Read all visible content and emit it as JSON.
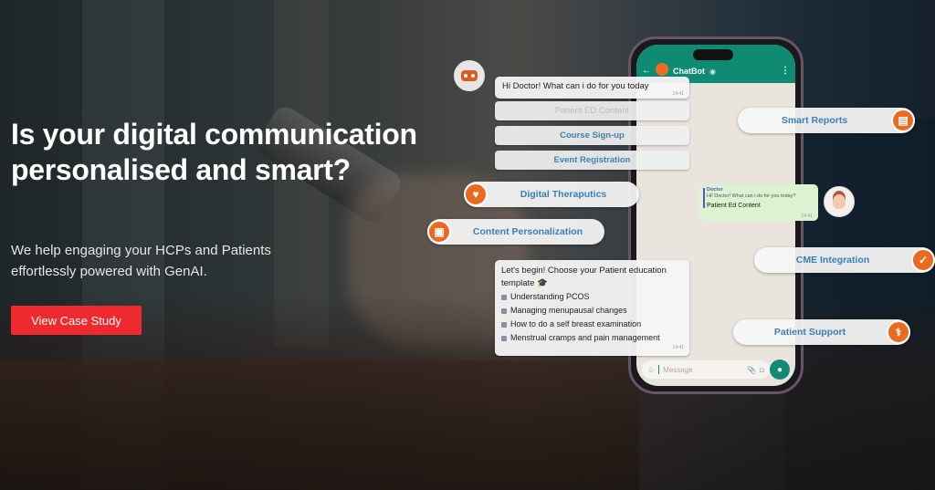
{
  "hero": {
    "title": "Is your digital communication personalised and smart?",
    "subtitle": "We help engaging your HCPs and Patients effortlessly powered with GenAI.",
    "cta_label": "View Case Study"
  },
  "colors": {
    "accent_red": "#ee2a2f",
    "whatsapp_green": "#0f8b73",
    "feature_orange": "#ea6a1f",
    "feature_text_blue": "#3c7fb6"
  },
  "phone": {
    "header_title": "ChatBot",
    "back_icon": "←",
    "menu_icon": "⋮",
    "input_placeholder": "Message",
    "mic_icon": "🎤"
  },
  "chat": {
    "greeting": "Hi Doctor! What can i do for you today",
    "greeting_time": "14:41",
    "options": [
      {
        "label": "Patient ED Content",
        "state": "disabled"
      },
      {
        "label": "Course Sign-up",
        "state": "enabled"
      },
      {
        "label": "Event Registration",
        "state": "enabled"
      }
    ],
    "doctor_reply": {
      "name": "Doctor",
      "quoted": "Hi! Doctor! What can i do for you today?",
      "text": "Patient Ed Content",
      "time": "14:41"
    },
    "template_message": {
      "intro": "Let's begin! Choose your Patient education template 🎓",
      "items": [
        "Understanding PCOS",
        "Managing menupausal changes",
        "How to do a self breast examination",
        "Menstrual cramps and pain management"
      ],
      "time": "14:41"
    }
  },
  "features": [
    {
      "label": "Digital Theraputics",
      "icon": "heart-pulse-icon",
      "glyph": "♥"
    },
    {
      "label": "Content Personalization",
      "icon": "image-icon",
      "glyph": "▣"
    },
    {
      "label": "Smart Reports",
      "icon": "report-icon",
      "glyph": "▤"
    },
    {
      "label": "CME Integration",
      "icon": "calendar-check-icon",
      "glyph": "✓"
    },
    {
      "label": "Patient Support",
      "icon": "stethoscope-icon",
      "glyph": "⚕"
    }
  ]
}
